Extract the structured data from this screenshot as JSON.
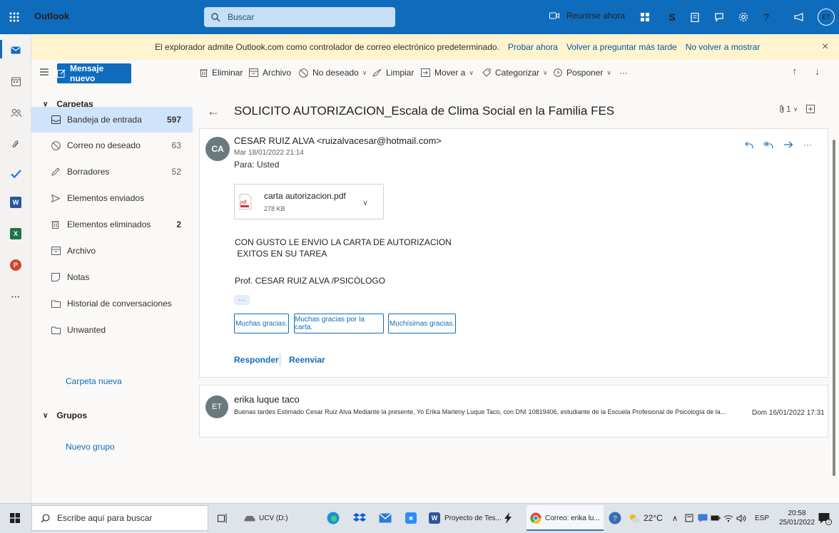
{
  "topbar": {
    "brand": "Outlook",
    "search_placeholder": "Buscar",
    "meet_now": "Reunirse ahora",
    "skype_letter": "S",
    "help_label": "?",
    "avatar": "ET"
  },
  "infobar": {
    "message": "El explorador admite Outlook.com como controlador de correo electrónico predeterminado.",
    "try_now": "Probar ahora",
    "ask_later": "Volver a preguntar más tarde",
    "dont_show": "No volver a mostrar",
    "close_glyph": "×"
  },
  "toolbar": {
    "new_mail": "Mensaje nuevo",
    "delete": "Eliminar",
    "archive": "Archivo",
    "junk": "No deseado",
    "sweep": "Limpiar",
    "move_to": "Mover a",
    "categorize": "Categorizar",
    "snooze": "Posponer",
    "more": "···"
  },
  "folders": {
    "header": "Carpetas",
    "items": [
      {
        "label": "Bandeja de entrada",
        "count": "597"
      },
      {
        "label": "Correo no deseado",
        "count": "63"
      },
      {
        "label": "Borradores",
        "count": "52"
      },
      {
        "label": "Elementos enviados",
        "count": ""
      },
      {
        "label": "Elementos eliminados",
        "count": "2"
      },
      {
        "label": "Archivo",
        "count": ""
      },
      {
        "label": "Notas",
        "count": ""
      },
      {
        "label": "Historial de conversaciones",
        "count": ""
      },
      {
        "label": "Unwanted",
        "count": ""
      }
    ],
    "new_folder": "Carpeta nueva",
    "groups_header": "Grupos",
    "new_group": "Nuevo grupo"
  },
  "reading": {
    "subject": "SOLICITO AUTORIZACION_Escala de Clima Social en la Familia FES",
    "attachment_count": "1",
    "message1": {
      "avatar": "CA",
      "sender": "CESAR RUIZ ALVA <ruizalvacesar@hotmail.com>",
      "date": "Mar 18/01/2022 21:14",
      "to": "Para:  Usted",
      "attachment_name": "carta autorizacion.pdf",
      "attachment_size": "278 KB",
      "body_line1": "CON GUSTO  LE ENVIO  LA CARTA DE  AUTORIZACION",
      "body_line2": " EXITOS EN SU TAREA",
      "signature": "Prof. CESAR RUIZ ALVA /PSICÓLOGO",
      "expand": "···",
      "quick_replies": [
        "Muchas gracias.",
        "Muchas gracias por la carta.",
        "Muchísimas gracias."
      ],
      "reply": "Responder",
      "forward": "Reenviar"
    },
    "message2": {
      "avatar": "ET",
      "sender": "erika luque taco",
      "preview": "Buenas tardes Estimado Cesar Ruiz Alva Mediante la presente, Yo Erika Marleny Luque Taco, con DNI 10819406, estudiante de la Escuela Profesional de Psicología de la...",
      "date": "Dom 16/01/2022 17:31"
    }
  },
  "taskbar": {
    "search_placeholder": "Escribe aquí para buscar",
    "drive": "UCV (D:)",
    "word_window": "Proyecto de Tes...",
    "outlook_window": "Correo: erika lu...",
    "weather": "22°C",
    "language": "ESP",
    "time": "20:58",
    "date": "25/01/2022",
    "notifications": "2"
  },
  "colors": {
    "brand": "#0f6cbd",
    "infobar": "#fff4ce",
    "selected_folder": "#cfe4fa"
  }
}
